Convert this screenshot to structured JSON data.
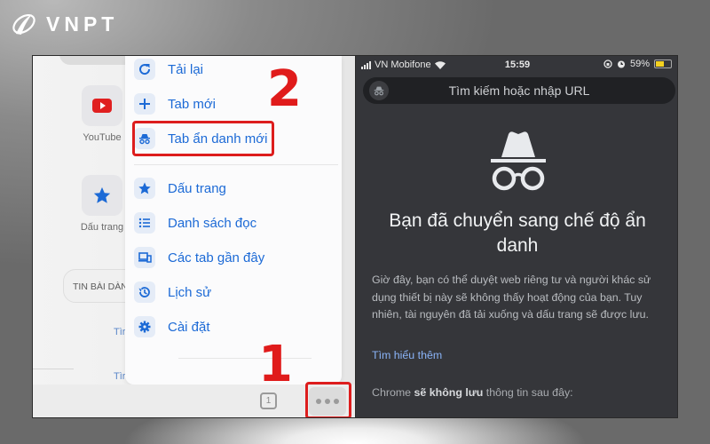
{
  "brand": {
    "name": "VNPT",
    "logo_icon": "vnpt-swoosh-icon"
  },
  "left_screen": {
    "shortcuts": [
      {
        "label": "YouTube",
        "icon": "youtube-icon"
      },
      {
        "label": "Dấu trang",
        "icon": "star-icon"
      }
    ],
    "news_pill": "TIN BÀI DÀNH",
    "news_links": [
      "Tìr",
      "Tìr"
    ],
    "menu": {
      "items": [
        {
          "label": "Tải lại",
          "icon": "reload-icon"
        },
        {
          "label": "Tab mới",
          "icon": "plus-icon"
        },
        {
          "label": "Tab ẩn danh mới",
          "icon": "incognito-icon",
          "highlighted": true
        },
        {
          "label": "Dấu trang",
          "icon": "star-icon"
        },
        {
          "label": "Danh sách đọc",
          "icon": "reading-list-icon"
        },
        {
          "label": "Các tab gần đây",
          "icon": "recent-tabs-icon"
        },
        {
          "label": "Lịch sử",
          "icon": "history-icon"
        },
        {
          "label": "Cài đặt",
          "icon": "gear-icon"
        }
      ]
    },
    "toolbar": {
      "tab_count": "1",
      "more_button": "more-options"
    },
    "annotations": {
      "step1": "1",
      "step2": "2",
      "highlight_color": "#dd1d1d"
    }
  },
  "right_screen": {
    "status_bar": {
      "carrier": "VN Mobifone",
      "time": "15:59",
      "battery": "59%",
      "battery_level": 0.59
    },
    "url_bar": {
      "placeholder": "Tìm kiếm hoặc nhập URL"
    },
    "title": "Bạn đã chuyển sang chế độ ẩn danh",
    "description": "Giờ đây, bạn có thể duyệt web riêng tư và người khác sử dụng thiết bị này sẽ không thấy hoạt động của bạn. Tuy nhiên, tài nguyên đã tải xuống và dấu trang sẽ được lưu.",
    "learn_more": "Tìm hiểu thêm",
    "not_saved": {
      "prefix": "Chrome ",
      "bold": "sẽ không lưu",
      "suffix": " thông tin sau đây:"
    },
    "accent_color": "#8ab4f8"
  }
}
